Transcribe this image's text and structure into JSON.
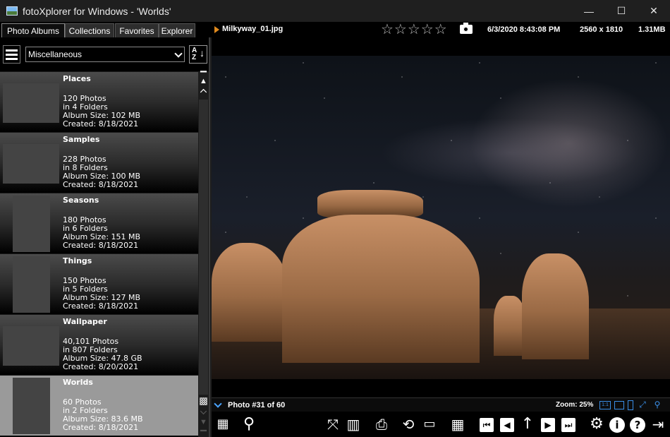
{
  "window": {
    "title": "fotoXplorer for Windows - 'Worlds'",
    "minimize": "—",
    "maximize": "☐",
    "close": "✕"
  },
  "tabs": [
    "Photo Albums",
    "Collections",
    "Favorites",
    "Explorer"
  ],
  "photo_info": {
    "filename": "Milkyway_01.jpg",
    "rating_stars": "☆☆☆☆☆",
    "datetime": "6/3/2020 8:43:08 PM",
    "dimensions": "2560 x 1810",
    "filesize": "1.31MB"
  },
  "sidebar": {
    "category": "Miscellaneous",
    "sort_label_top": "A",
    "sort_label_bottom": "Z",
    "sort_arrow": "↓",
    "albums": [
      {
        "name": "Places",
        "photos": "120 Photos",
        "folders": "in 4 Folders",
        "size": "Album Size: 102 MB",
        "created": "Created: 8/18/2021"
      },
      {
        "name": "Samples",
        "photos": "228 Photos",
        "folders": "in 8 Folders",
        "size": "Album Size: 100 MB",
        "created": "Created: 8/18/2021"
      },
      {
        "name": "Seasons",
        "photos": "180 Photos",
        "folders": "in 6 Folders",
        "size": "Album Size: 151 MB",
        "created": "Created: 8/18/2021"
      },
      {
        "name": "Things",
        "photos": "150 Photos",
        "folders": "in 5 Folders",
        "size": "Album Size: 127 MB",
        "created": "Created: 8/18/2021"
      },
      {
        "name": "Wallpaper",
        "photos": "40,101 Photos",
        "folders": "in 807 Folders",
        "size": "Album Size: 47.8 GB",
        "created": "Created: 8/20/2021"
      },
      {
        "name": "Worlds",
        "photos": "60 Photos",
        "folders": "in 2 Folders",
        "size": "Album Size: 83.6 MB",
        "created": "Created: 8/18/2021"
      }
    ]
  },
  "status": {
    "photo_number": "Photo #31 of 60",
    "zoom": "Zoom: 25%",
    "zoom_1to1": "1:1"
  },
  "colors": {
    "accent_blue": "#3a8ee6",
    "play_orange": "#e08a1e",
    "selected_album": "#9a9a9a"
  },
  "icons": {
    "toolbar": [
      "slideshow-grid-icon",
      "search-icon",
      "fullscreen-icon",
      "film-icon",
      "print-icon",
      "rotate-icon",
      "image-folder-icon",
      "grid-icon",
      "first-icon",
      "prev-icon",
      "up-icon",
      "next-icon",
      "last-icon",
      "settings-icon",
      "info-icon",
      "help-icon",
      "exit-icon"
    ]
  }
}
